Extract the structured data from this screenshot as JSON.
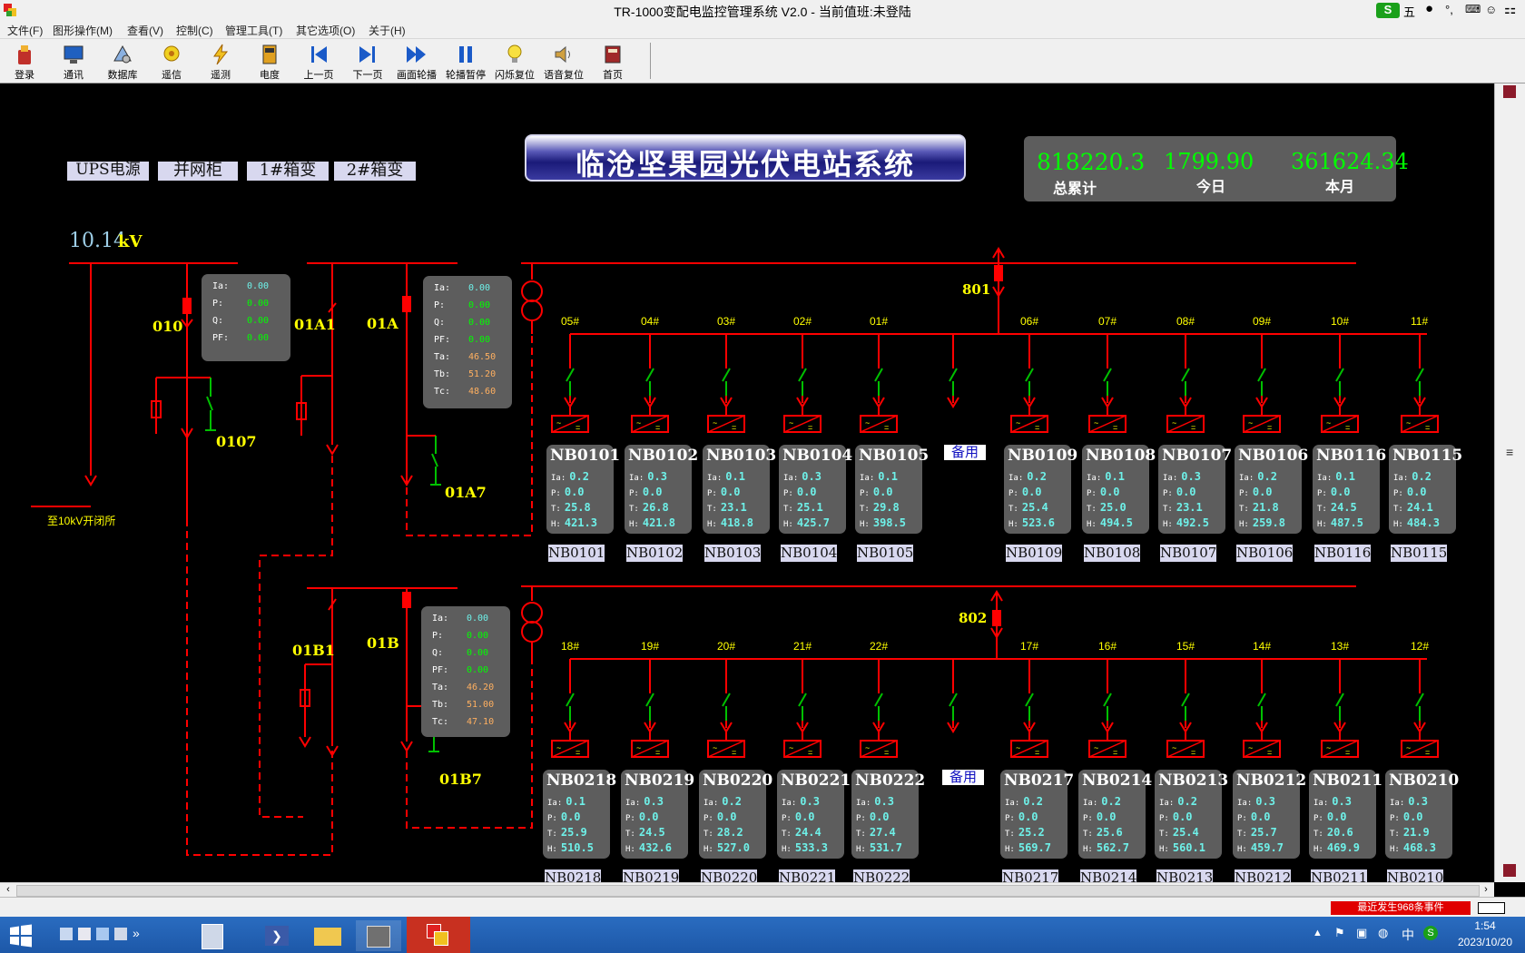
{
  "window": {
    "title": "TR-1000变配电监控管理系统 V2.0 - 当前值班:未登陆",
    "ime_char": "五"
  },
  "menu": [
    "文件(F)",
    "图形操作(M)",
    "查看(V)",
    "控制(C)",
    "管理工具(T)",
    "其它选项(O)",
    "关于(H)"
  ],
  "toolbar": [
    {
      "label": "登录",
      "icon": "login-icon"
    },
    {
      "label": "通讯",
      "icon": "monitor-icon"
    },
    {
      "label": "数据库",
      "icon": "database-icon"
    },
    {
      "label": "遥信",
      "icon": "lightbulb-gear-icon"
    },
    {
      "label": "遥测",
      "icon": "lightning-icon"
    },
    {
      "label": "电度",
      "icon": "meter-icon"
    },
    {
      "label": "上一页",
      "icon": "prev-page-icon"
    },
    {
      "label": "下一页",
      "icon": "next-page-icon"
    },
    {
      "label": "画面轮播",
      "icon": "fast-forward-icon"
    },
    {
      "label": "轮播暂停",
      "icon": "pause-icon"
    },
    {
      "label": "闪烁复位",
      "icon": "bulb-icon"
    },
    {
      "label": "语音复位",
      "icon": "speaker-icon"
    },
    {
      "label": "首页",
      "icon": "book-icon"
    }
  ],
  "nav_buttons": [
    "UPS电源",
    "并网柜",
    "1#箱变",
    "2#箱变"
  ],
  "station_title": "临沧坚果园光伏电站系统",
  "energy": {
    "total_value": "818220.3",
    "total_label": "总累计",
    "today_value": "1799.90",
    "today_label": "今日",
    "month_value": "361624.34",
    "month_label": "本月"
  },
  "bus_voltage": {
    "value": "10.14",
    "unit": "kV"
  },
  "feed_label": "至10kV开闭所",
  "breakers": [
    "010",
    "01A1",
    "01A",
    "0107",
    "01A7",
    "01B1",
    "01B",
    "01B7",
    "801",
    "802"
  ],
  "meter_010": [
    {
      "k": "Ia:",
      "v": "0.00"
    },
    {
      "k": "P:",
      "v": "0.00"
    },
    {
      "k": "Q:",
      "v": "0.00"
    },
    {
      "k": "PF:",
      "v": "0.00"
    }
  ],
  "meter_01A": [
    {
      "k": "Ia:",
      "v": "0.00"
    },
    {
      "k": "P:",
      "v": "0.00"
    },
    {
      "k": "Q:",
      "v": "0.00"
    },
    {
      "k": "PF:",
      "v": "0.00"
    },
    {
      "k": "Ta:",
      "v": "46.50"
    },
    {
      "k": "Tb:",
      "v": "51.20"
    },
    {
      "k": "Tc:",
      "v": "48.60"
    }
  ],
  "meter_01B": [
    {
      "k": "Ia:",
      "v": "0.00"
    },
    {
      "k": "P:",
      "v": "0.00"
    },
    {
      "k": "Q:",
      "v": "0.00"
    },
    {
      "k": "PF:",
      "v": "0.00"
    },
    {
      "k": "Ta:",
      "v": "46.20"
    },
    {
      "k": "Tb:",
      "v": "51.00"
    },
    {
      "k": "Tc:",
      "v": "47.10"
    }
  ],
  "spare_label": "备用",
  "row1_branches": [
    "05#",
    "04#",
    "03#",
    "02#",
    "01#",
    "",
    "06#",
    "07#",
    "08#",
    "09#",
    "10#",
    "11#"
  ],
  "row2_branches": [
    "18#",
    "19#",
    "20#",
    "21#",
    "22#",
    "",
    "17#",
    "16#",
    "15#",
    "14#",
    "13#",
    "12#"
  ],
  "row1_inverters": [
    {
      "name": "NB0101",
      "ia": "0.2",
      "p": "0.0",
      "t": "25.8",
      "h": "421.3"
    },
    {
      "name": "NB0102",
      "ia": "0.3",
      "p": "0.0",
      "t": "26.8",
      "h": "421.8"
    },
    {
      "name": "NB0103",
      "ia": "0.1",
      "p": "0.0",
      "t": "23.1",
      "h": "418.8"
    },
    {
      "name": "NB0104",
      "ia": "0.3",
      "p": "0.0",
      "t": "25.1",
      "h": "425.7"
    },
    {
      "name": "NB0105",
      "ia": "0.1",
      "p": "0.0",
      "t": "29.8",
      "h": "398.5"
    },
    {
      "name": "NB0109",
      "ia": "0.2",
      "p": "0.0",
      "t": "25.4",
      "h": "523.6"
    },
    {
      "name": "NB0108",
      "ia": "0.1",
      "p": "0.0",
      "t": "25.0",
      "h": "494.5"
    },
    {
      "name": "NB0107",
      "ia": "0.3",
      "p": "0.0",
      "t": "23.1",
      "h": "492.5"
    },
    {
      "name": "NB0106",
      "ia": "0.2",
      "p": "0.0",
      "t": "21.8",
      "h": "259.8"
    },
    {
      "name": "NB0116",
      "ia": "0.1",
      "p": "0.0",
      "t": "24.5",
      "h": "487.5"
    },
    {
      "name": "NB0115",
      "ia": "0.2",
      "p": "0.0",
      "t": "24.1",
      "h": "484.3"
    }
  ],
  "row2_inverters": [
    {
      "name": "NB0218",
      "ia": "0.1",
      "p": "0.0",
      "t": "25.9",
      "h": "510.5"
    },
    {
      "name": "NB0219",
      "ia": "0.3",
      "p": "0.0",
      "t": "24.5",
      "h": "432.6"
    },
    {
      "name": "NB0220",
      "ia": "0.2",
      "p": "0.0",
      "t": "28.2",
      "h": "527.0"
    },
    {
      "name": "NB0221",
      "ia": "0.3",
      "p": "0.0",
      "t": "24.4",
      "h": "533.3"
    },
    {
      "name": "NB0222",
      "ia": "0.3",
      "p": "0.0",
      "t": "27.4",
      "h": "531.7"
    },
    {
      "name": "NB0217",
      "ia": "0.2",
      "p": "0.0",
      "t": "25.2",
      "h": "569.7"
    },
    {
      "name": "NB0214",
      "ia": "0.2",
      "p": "0.0",
      "t": "25.6",
      "h": "562.7"
    },
    {
      "name": "NB0213",
      "ia": "0.2",
      "p": "0.0",
      "t": "25.4",
      "h": "560.1"
    },
    {
      "name": "NB0212",
      "ia": "0.3",
      "p": "0.0",
      "t": "25.7",
      "h": "459.7"
    },
    {
      "name": "NB0211",
      "ia": "0.3",
      "p": "0.0",
      "t": "20.6",
      "h": "469.9"
    },
    {
      "name": "NB0210",
      "ia": "0.3",
      "p": "0.0",
      "t": "21.9",
      "h": "468.3"
    }
  ],
  "field_labels": {
    "ia": "Ia:",
    "p": "P:",
    "t": "T:",
    "h": "H:"
  },
  "status": {
    "alarm": "最近发生968条事件"
  },
  "taskbar": {
    "time": "1:54",
    "date": "2023/10/20",
    "tray_ime": "中"
  },
  "colors": {
    "line": "#ff0000",
    "tag": "#ffff00",
    "value_cyan": "#6ef0e8",
    "value_green": "#00ff00",
    "value_orange": "#ffb060",
    "panel": "#5d5d5d"
  }
}
